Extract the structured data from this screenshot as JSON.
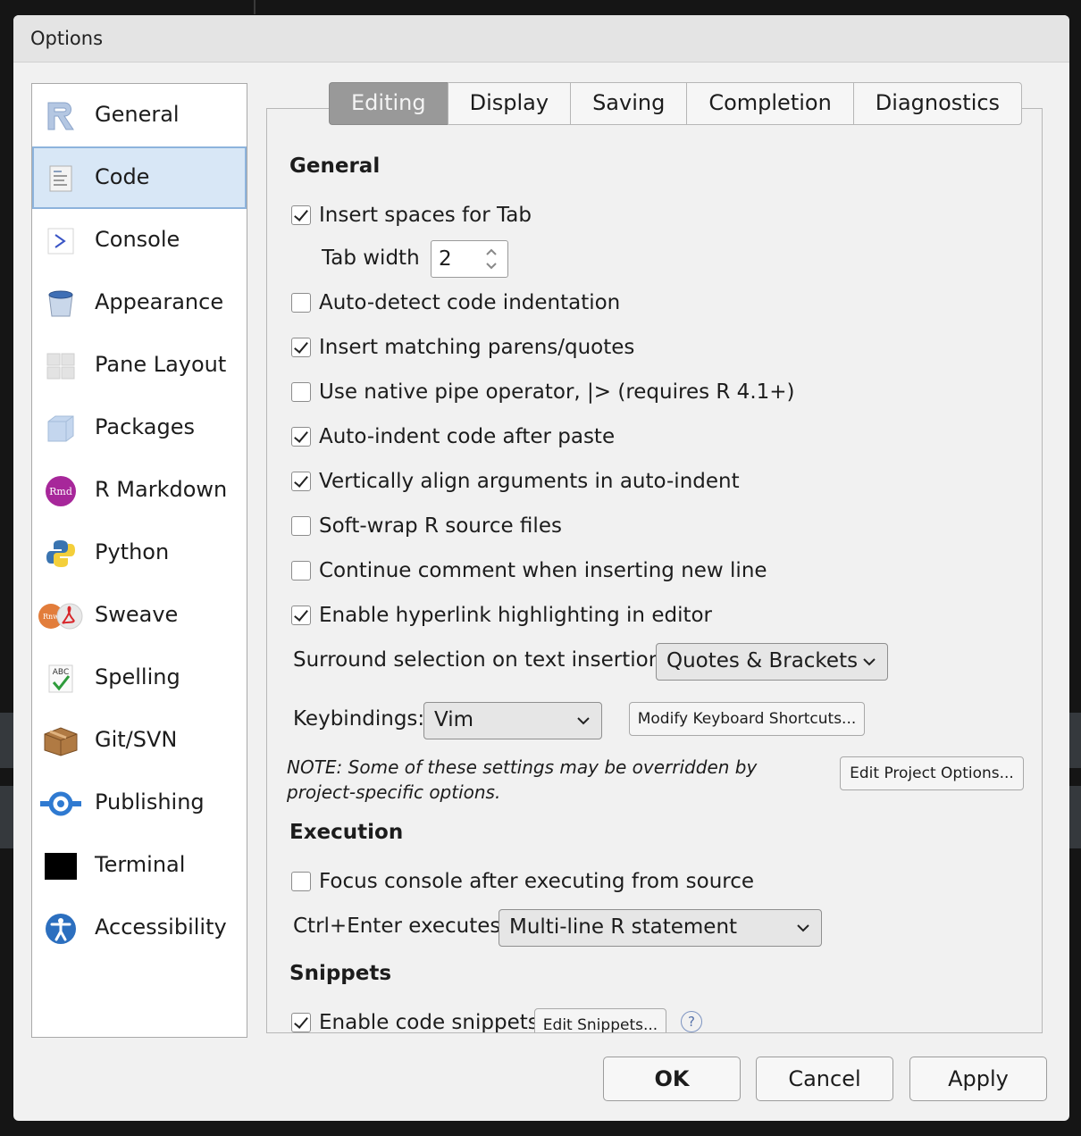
{
  "dialog": {
    "title": "Options"
  },
  "sidebar": {
    "items": [
      {
        "label": "General",
        "icon": "r-logo-icon"
      },
      {
        "label": "Code",
        "icon": "code-file-icon",
        "selected": true
      },
      {
        "label": "Console",
        "icon": "console-prompt-icon"
      },
      {
        "label": "Appearance",
        "icon": "paint-bucket-icon"
      },
      {
        "label": "Pane Layout",
        "icon": "pane-layout-icon"
      },
      {
        "label": "Packages",
        "icon": "package-box-icon"
      },
      {
        "label": "R Markdown",
        "icon": "rmd-icon"
      },
      {
        "label": "Python",
        "icon": "python-icon"
      },
      {
        "label": "Sweave",
        "icon": "sweave-pdf-icon"
      },
      {
        "label": "Spelling",
        "icon": "spelling-abc-icon"
      },
      {
        "label": "Git/SVN",
        "icon": "git-box-icon"
      },
      {
        "label": "Publishing",
        "icon": "publishing-icon"
      },
      {
        "label": "Terminal",
        "icon": "terminal-icon"
      },
      {
        "label": "Accessibility",
        "icon": "accessibility-icon"
      }
    ]
  },
  "tabs": [
    {
      "label": "Editing",
      "active": true
    },
    {
      "label": "Display"
    },
    {
      "label": "Saving"
    },
    {
      "label": "Completion"
    },
    {
      "label": "Diagnostics"
    }
  ],
  "general": {
    "title": "General",
    "insert_spaces": {
      "label": "Insert spaces for Tab",
      "checked": true
    },
    "tab_width": {
      "label": "Tab width",
      "value": "2"
    },
    "auto_detect": {
      "label": "Auto-detect code indentation",
      "checked": false
    },
    "insert_matching": {
      "label": "Insert matching parens/quotes",
      "checked": true
    },
    "native_pipe": {
      "label": "Use native pipe operator, |> (requires R 4.1+)",
      "checked": false
    },
    "auto_indent": {
      "label": "Auto-indent code after paste",
      "checked": true
    },
    "vertical_align": {
      "label": "Vertically align arguments in auto-indent",
      "checked": true
    },
    "soft_wrap": {
      "label": "Soft-wrap R source files",
      "checked": false
    },
    "continue_comment": {
      "label": "Continue comment when inserting new line",
      "checked": false
    },
    "hyperlink": {
      "label": "Enable hyperlink highlighting in editor",
      "checked": true
    },
    "surround": {
      "label": "Surround selection on text insertion:",
      "value": "Quotes & Brackets"
    },
    "keybindings": {
      "label": "Keybindings:",
      "value": "Vim"
    },
    "modify_shortcuts": "Modify Keyboard Shortcuts...",
    "note": "NOTE: Some of these settings may be overridden by project-specific options.",
    "edit_project": "Edit Project Options..."
  },
  "execution": {
    "title": "Execution",
    "focus_console": {
      "label": "Focus console after executing from source",
      "checked": false
    },
    "ctrl_enter": {
      "label": "Ctrl+Enter executes:",
      "value": "Multi-line R statement"
    }
  },
  "snippets": {
    "title": "Snippets",
    "enable": {
      "label": "Enable code snippets",
      "checked": true
    },
    "edit_button": "Edit Snippets...",
    "help": "?"
  },
  "footer": {
    "ok": "OK",
    "cancel": "Cancel",
    "apply": "Apply"
  }
}
